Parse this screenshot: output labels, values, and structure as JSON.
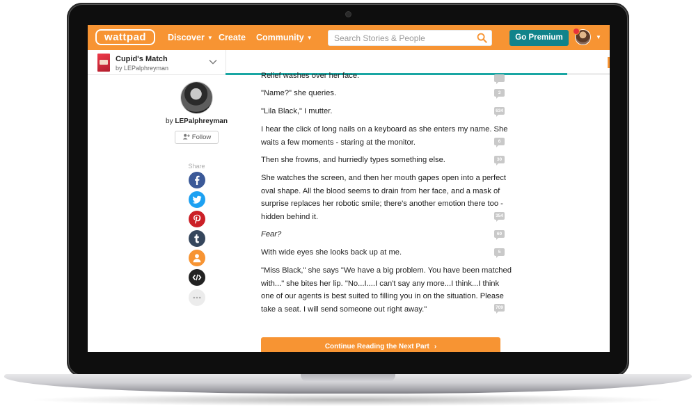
{
  "navbar": {
    "logo": "wattpad",
    "links": [
      "Discover",
      "Create",
      "Community"
    ],
    "search_placeholder": "Search Stories & People",
    "premium_label": "Go Premium",
    "brand_color": "#f79433",
    "premium_color": "#10838b"
  },
  "story": {
    "title": "Cupid's Match",
    "author": "by LEPalphreyman",
    "reading_progress": 0.89
  },
  "author_panel": {
    "by": "by",
    "name": "LEPalphreyman",
    "follow_label": "Follow",
    "share_label": "Share",
    "share_icons": [
      "facebook-icon",
      "twitter-icon",
      "pinterest-icon",
      "tumblr-icon",
      "user-icon",
      "embed-icon",
      "more-icon"
    ]
  },
  "reader": {
    "partial_top_line": "Relief washes over her face.",
    "paragraphs": [
      {
        "lines": [
          "\"Name?\" she queries."
        ],
        "comments": "3"
      },
      {
        "lines": [
          "\"Lila Black,\" I mutter."
        ],
        "comments": "634"
      },
      {
        "lines": [
          "I hear the click of long nails on a keyboard as she enters my name. She",
          "waits a few moments - staring at the monitor."
        ],
        "comments": "6"
      },
      {
        "lines": [
          "Then she frowns, and hurriedly types something else."
        ],
        "comments": "30"
      },
      {
        "lines": [
          "She watches the screen, and then her mouth gapes open into a perfect",
          "oval shape. All the blood seems to drain from her face, and a mask of",
          "surprise replaces her robotic smile; there's another emotion there too -",
          "hidden behind it."
        ],
        "comments": "354"
      },
      {
        "lines": [
          "Fear?"
        ],
        "comments": "60"
      },
      {
        "lines": [
          "With wide eyes she looks back up at me."
        ],
        "comments": "5"
      },
      {
        "lines": [
          "\"Miss Black,\" she says \"We have a big problem. You have been matched",
          "with...\" she bites her lip. \"No...I....I can't say any more...I think...I think",
          "one of our agents is best suited to filling you in on the situation. Please",
          "take a seat. I will send someone out right away.\""
        ],
        "comments": "709"
      }
    ],
    "continue_label": "Continue Reading the Next Part"
  }
}
